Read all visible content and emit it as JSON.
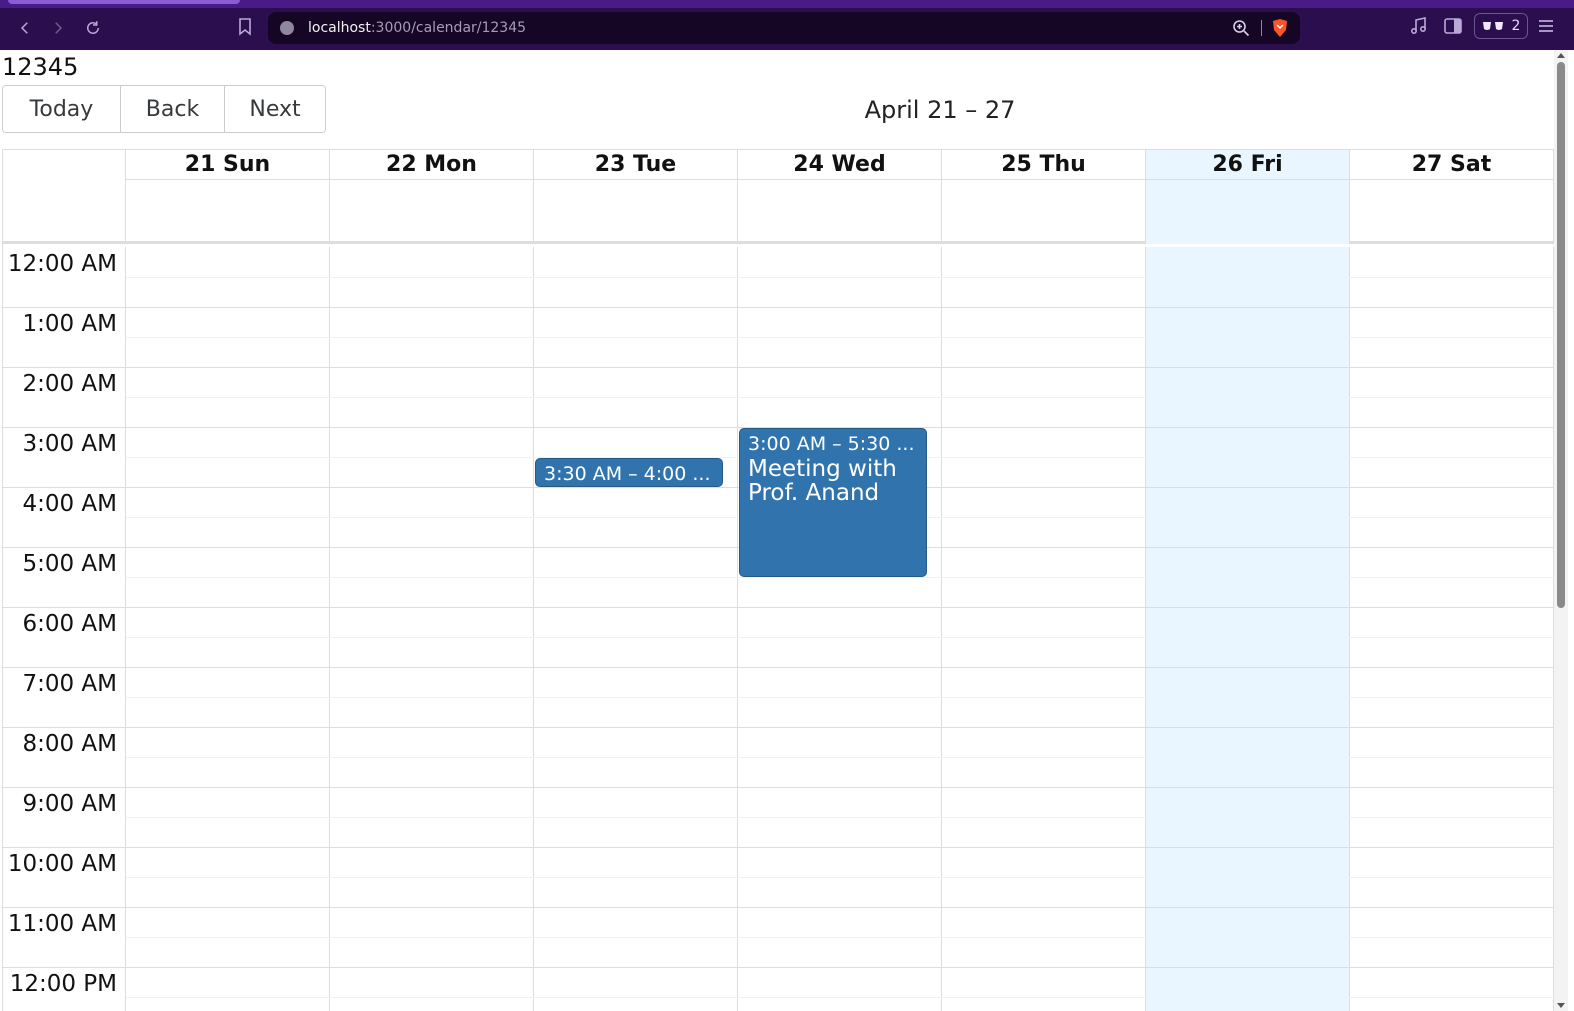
{
  "browser": {
    "url_host": "localhost",
    "url_path": ":3000/calendar/12345",
    "wallet_count": "2"
  },
  "page": {
    "calendar_id": "12345",
    "toolbar": {
      "today_label": "Today",
      "back_label": "Back",
      "next_label": "Next",
      "range_label": "April 21 – 27"
    },
    "days": [
      {
        "label": "21 Sun",
        "today": false
      },
      {
        "label": "22 Mon",
        "today": false
      },
      {
        "label": "23 Tue",
        "today": false
      },
      {
        "label": "24 Wed",
        "today": false
      },
      {
        "label": "25 Thu",
        "today": false
      },
      {
        "label": "26 Fri",
        "today": true
      },
      {
        "label": "27 Sat",
        "today": false
      }
    ],
    "time_slots": [
      "12:00 AM",
      "1:00 AM",
      "2:00 AM",
      "3:00 AM",
      "4:00 AM",
      "5:00 AM",
      "6:00 AM",
      "7:00 AM",
      "8:00 AM",
      "9:00 AM",
      "10:00 AM",
      "11:00 AM",
      "12:00 PM"
    ],
    "events": [
      {
        "day": 2,
        "start_hour": 3.5,
        "end_hour": 4.0,
        "time_label": "3:30 AM – 4:00 ...",
        "title": ""
      },
      {
        "day": 3,
        "start_hour": 3.0,
        "end_hour": 5.5,
        "time_label": "3:00 AM – 5:30 ...",
        "title": "Meeting with Prof. Anand"
      }
    ]
  },
  "colors": {
    "event_bg": "#3174ad",
    "today_bg": "#eaf6ff",
    "chrome_bg": "#2b0e4e"
  }
}
